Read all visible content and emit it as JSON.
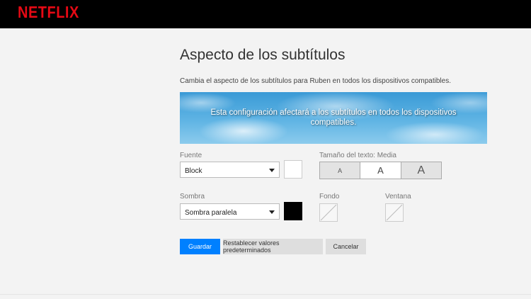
{
  "brand": {
    "logo": "NETFLIX",
    "color": "#e50914"
  },
  "page": {
    "title": "Aspecto de los subtítulos",
    "description": "Cambia el aspecto de los subtítulos para Ruben en todos los dispositivos compatibles."
  },
  "preview": {
    "line1": "Esta configuración afectará a los subtítulos en todos los dispositivos",
    "line2": "compatibles."
  },
  "font": {
    "label": "Fuente",
    "value": "Block",
    "color": "#ffffff"
  },
  "text_size": {
    "label": "Tamaño del texto: Media",
    "options": [
      "A",
      "A",
      "A"
    ],
    "selected": "Media"
  },
  "shadow": {
    "label": "Sombra",
    "value": "Sombra paralela",
    "color": "#000000"
  },
  "background": {
    "label": "Fondo"
  },
  "window": {
    "label": "Ventana"
  },
  "actions": {
    "save": "Guardar",
    "reset": "Restablecer valores predeterminados",
    "cancel": "Cancelar"
  },
  "colors": {
    "accent": "#0080ff",
    "topbar": "#000000"
  }
}
